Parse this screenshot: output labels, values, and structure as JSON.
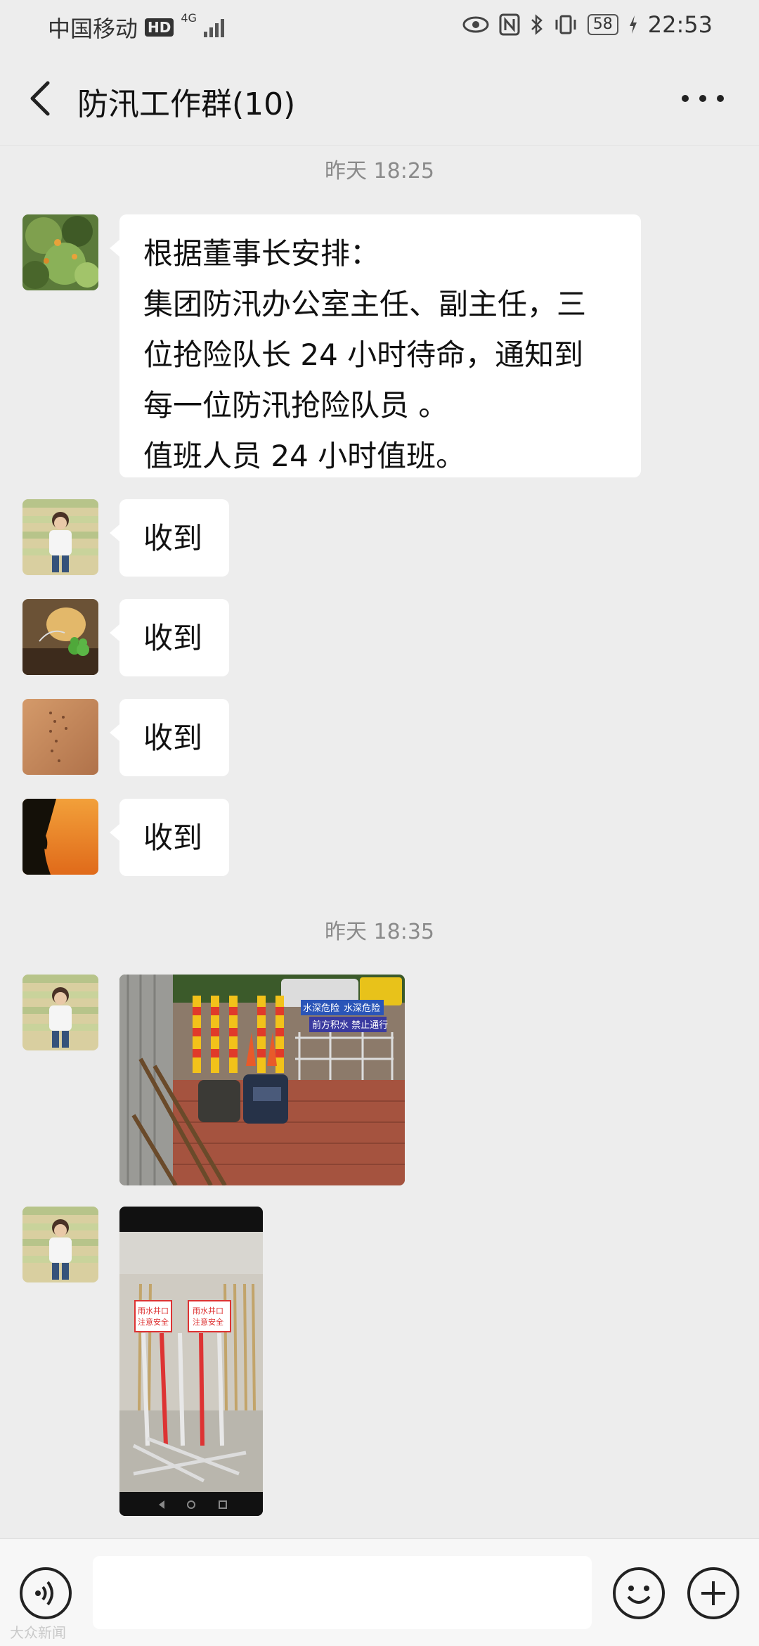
{
  "status_bar": {
    "carrier": "中国移动",
    "hd_badge": "HD",
    "network": "4G",
    "battery": "58",
    "time": "22:53"
  },
  "header": {
    "title": "防汛工作群(10)",
    "back_icon": "chevron-left-icon",
    "more_icon": "more-dots-icon"
  },
  "timestamps": [
    "昨天 18:25",
    "昨天 18:35"
  ],
  "messages": [
    {
      "type": "text",
      "lines": [
        "根据董事长安排：",
        "集团防汛办公室主任、副主任，三",
        "位抢险队长 24 小时待命，通知到",
        "每一位防汛抢险队员 。",
        "值班人员 24 小时值班。"
      ]
    },
    {
      "type": "text",
      "text": "收到"
    },
    {
      "type": "text",
      "text": "收到"
    },
    {
      "type": "text",
      "text": "收到"
    },
    {
      "type": "text",
      "text": "收到"
    }
  ],
  "photo1_signs": [
    "水深危险",
    "水深危险",
    "前方积水 禁止通行"
  ],
  "photo2_signs": [
    "雨水井口",
    "注意安全",
    "雨水井口",
    "注意安全"
  ],
  "input_bar": {
    "voice_icon": "voice-icon",
    "emoji_icon": "emoji-icon",
    "plus_icon": "plus-icon"
  },
  "watermark": "大众新闻"
}
